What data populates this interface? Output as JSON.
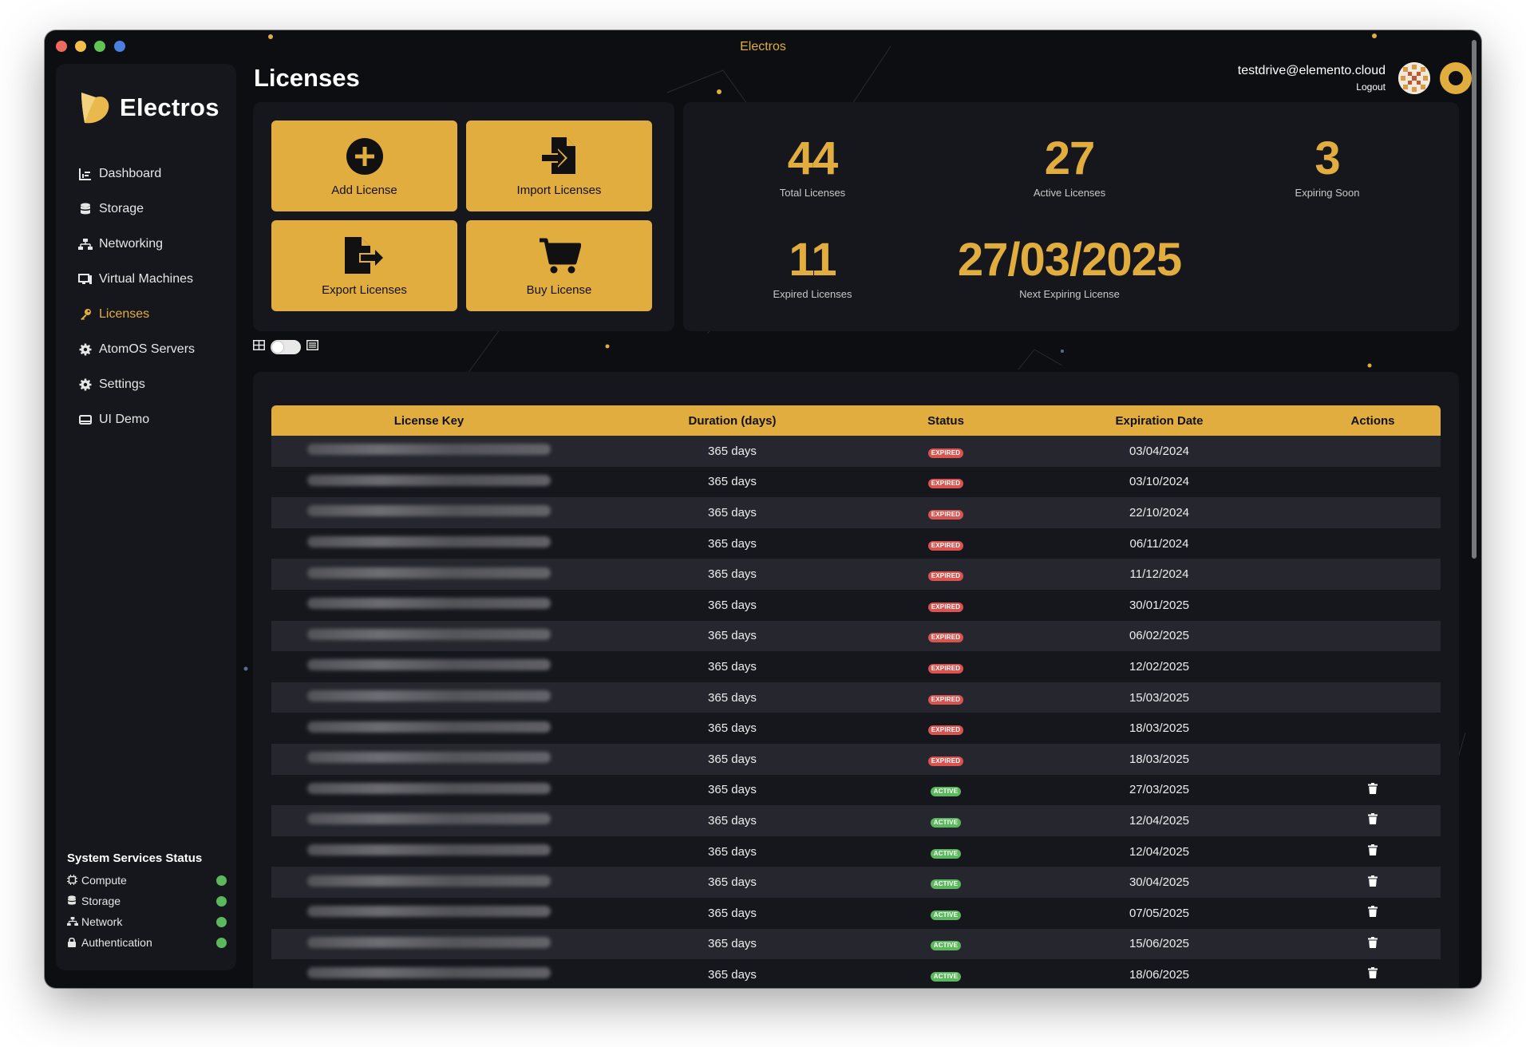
{
  "window": {
    "title": "Electros"
  },
  "brand": {
    "name": "Electros"
  },
  "sidebar": {
    "items": [
      {
        "label": "Dashboard",
        "icon": "chart-icon"
      },
      {
        "label": "Storage",
        "icon": "database-icon"
      },
      {
        "label": "Networking",
        "icon": "network-icon"
      },
      {
        "label": "Virtual Machines",
        "icon": "monitor-icon"
      },
      {
        "label": "Licenses",
        "icon": "key-icon",
        "active": true
      },
      {
        "label": "AtomOS Servers",
        "icon": "server-gear-icon"
      },
      {
        "label": "Settings",
        "icon": "gear-icon"
      },
      {
        "label": "UI Demo",
        "icon": "drive-icon"
      }
    ],
    "system_status": {
      "title": "System Services Status",
      "services": [
        {
          "label": "Compute",
          "status": "ok"
        },
        {
          "label": "Storage",
          "status": "ok"
        },
        {
          "label": "Network",
          "status": "ok"
        },
        {
          "label": "Authentication",
          "status": "ok"
        }
      ]
    }
  },
  "header": {
    "title": "Licenses",
    "user_email": "testdrive@elemento.cloud",
    "logout": "Logout"
  },
  "actions": {
    "add": "Add License",
    "import": "Import Licenses",
    "export": "Export Licenses",
    "buy": "Buy License"
  },
  "stats": {
    "total": {
      "value": "44",
      "label": "Total Licenses"
    },
    "active": {
      "value": "27",
      "label": "Active Licenses"
    },
    "expiring": {
      "value": "3",
      "label": "Expiring Soon"
    },
    "expired": {
      "value": "11",
      "label": "Expired Licenses"
    },
    "next": {
      "value": "27/03/2025",
      "label": "Next Expiring License"
    }
  },
  "table": {
    "headers": [
      "License Key",
      "Duration (days)",
      "Status",
      "Expiration Date",
      "Actions"
    ],
    "rows": [
      {
        "duration": "365 days",
        "status": "EXPIRED",
        "date": "03/04/2024"
      },
      {
        "duration": "365 days",
        "status": "EXPIRED",
        "date": "03/10/2024"
      },
      {
        "duration": "365 days",
        "status": "EXPIRED",
        "date": "22/10/2024"
      },
      {
        "duration": "365 days",
        "status": "EXPIRED",
        "date": "06/11/2024"
      },
      {
        "duration": "365 days",
        "status": "EXPIRED",
        "date": "11/12/2024"
      },
      {
        "duration": "365 days",
        "status": "EXPIRED",
        "date": "30/01/2025"
      },
      {
        "duration": "365 days",
        "status": "EXPIRED",
        "date": "06/02/2025"
      },
      {
        "duration": "365 days",
        "status": "EXPIRED",
        "date": "12/02/2025"
      },
      {
        "duration": "365 days",
        "status": "EXPIRED",
        "date": "15/03/2025"
      },
      {
        "duration": "365 days",
        "status": "EXPIRED",
        "date": "18/03/2025"
      },
      {
        "duration": "365 days",
        "status": "EXPIRED",
        "date": "18/03/2025"
      },
      {
        "duration": "365 days",
        "status": "ACTIVE",
        "date": "27/03/2025"
      },
      {
        "duration": "365 days",
        "status": "ACTIVE",
        "date": "12/04/2025"
      },
      {
        "duration": "365 days",
        "status": "ACTIVE",
        "date": "12/04/2025"
      },
      {
        "duration": "365 days",
        "status": "ACTIVE",
        "date": "30/04/2025"
      },
      {
        "duration": "365 days",
        "status": "ACTIVE",
        "date": "07/05/2025"
      },
      {
        "duration": "365 days",
        "status": "ACTIVE",
        "date": "15/06/2025"
      },
      {
        "duration": "365 days",
        "status": "ACTIVE",
        "date": "18/06/2025"
      }
    ]
  },
  "colors": {
    "accent": "#e2ad3f",
    "background": "#0d0e12",
    "panel": "#16171d",
    "expired": "#d9534f",
    "active": "#5cb85c"
  }
}
